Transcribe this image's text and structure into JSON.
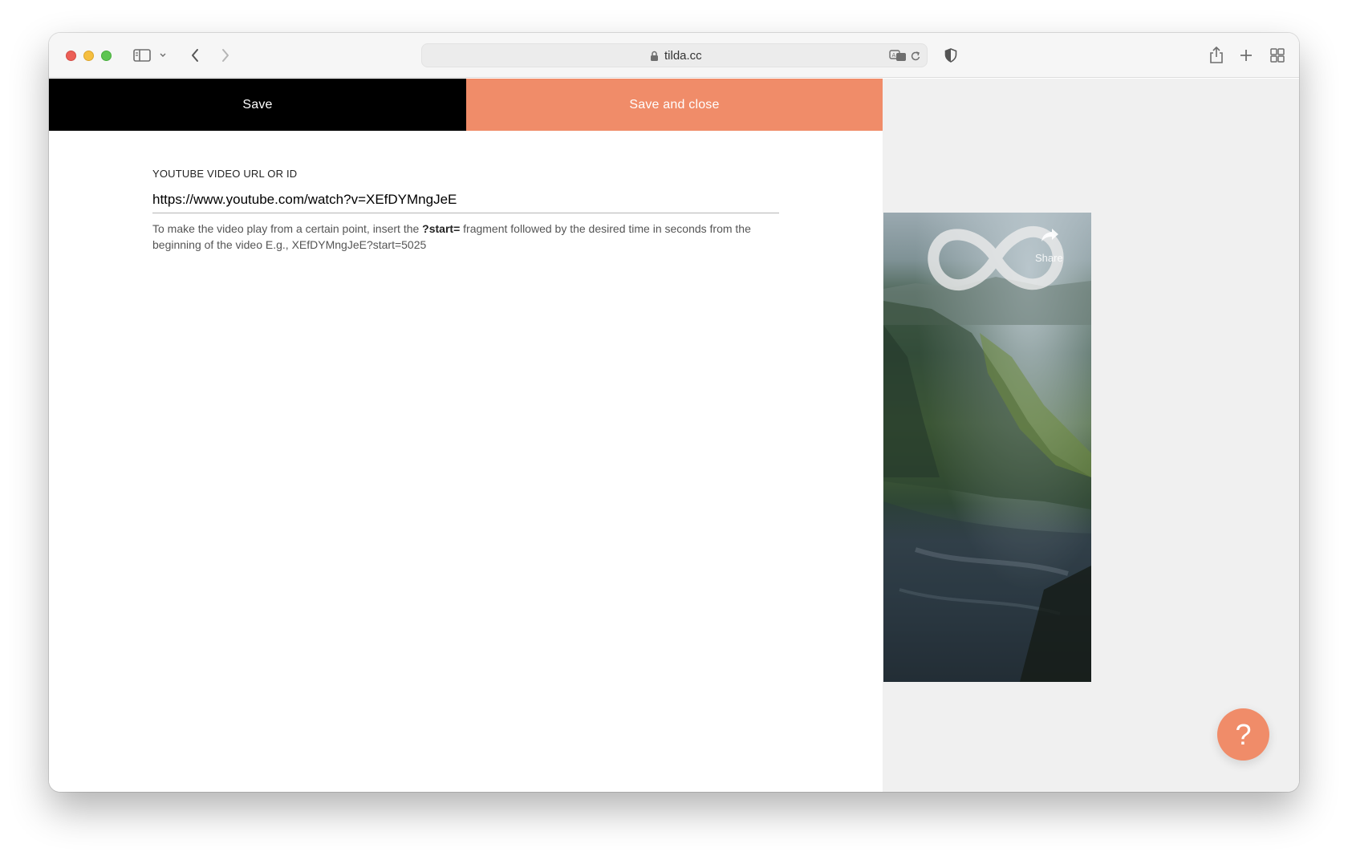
{
  "browser": {
    "url": "tilda.cc"
  },
  "editor": {
    "save_label": "Save",
    "save_close_label": "Save and close",
    "field_label": "YOUTUBE VIDEO URL OR ID",
    "field_value": "https://www.youtube.com/watch?v=XEfDYMngJeE",
    "hint_before": "To make the video play from a certain point, insert the ",
    "hint_code": "?start=",
    "hint_after": " fragment followed by the desired time in seconds from the beginning of the video E.g., XEfDYMngJeE?start=5025"
  },
  "preview": {
    "share_label": "Share"
  },
  "help": {
    "label": "?"
  },
  "colors": {
    "accent": "#f08c69",
    "save_button": "#000000"
  },
  "icons": [
    "sidebar-icon",
    "chevron-down-icon",
    "back-icon",
    "forward-icon",
    "lock-icon",
    "translate-icon",
    "reload-icon",
    "shield-icon",
    "share-icon",
    "new-tab-icon",
    "tab-overview-icon",
    "loop-icon",
    "share-arrow-icon"
  ]
}
